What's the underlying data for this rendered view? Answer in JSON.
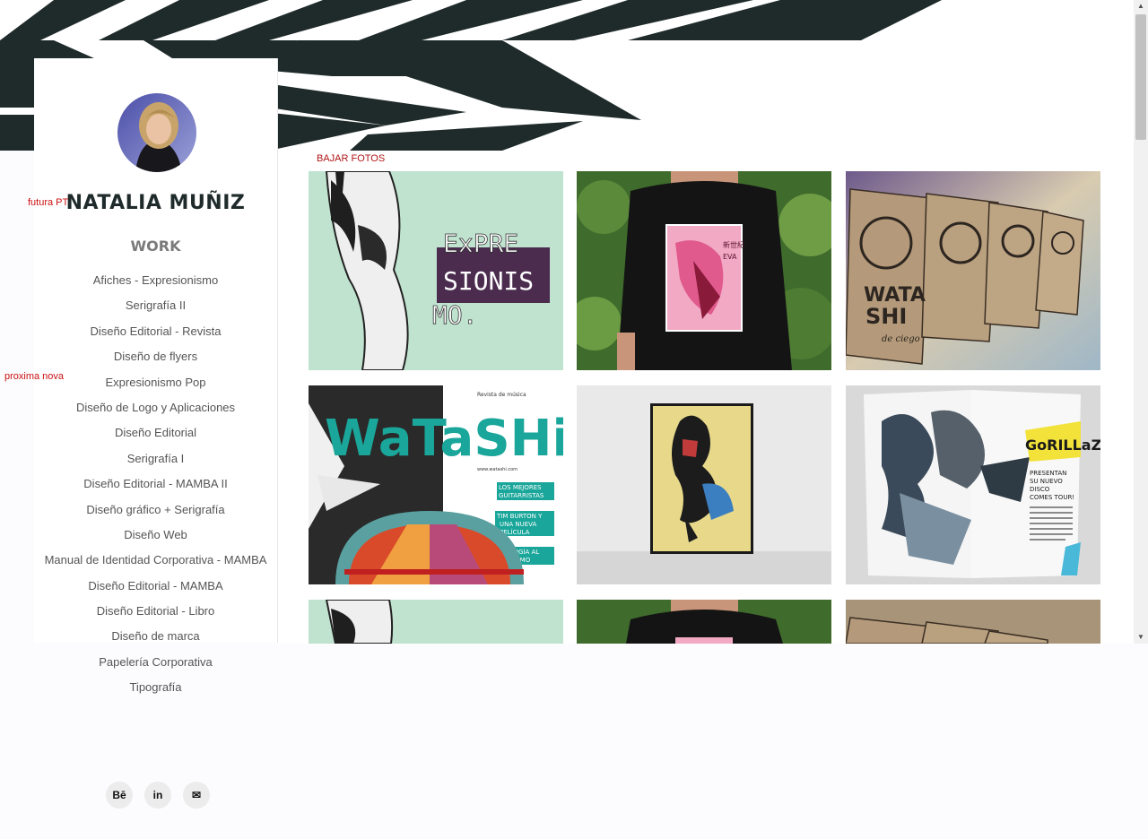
{
  "profile": {
    "name": "NATALIA MUÑIZ",
    "section_title": "WORK"
  },
  "annotations": {
    "font_note": "futura PT",
    "nav_note": "proxima nova",
    "download_label": "BAJAR FOTOS"
  },
  "nav": {
    "items": [
      "Afiches - Expresionismo",
      "Serigrafía II",
      "Diseño Editorial - Revista",
      "Diseño de flyers",
      "Expresionismo Pop",
      "Diseño de Logo y Aplicaciones",
      "Diseño Editorial",
      "Serigrafía I",
      "Diseño Editorial - MAMBA II",
      "Diseño gráfico + Serigrafía",
      "Diseño Web",
      "Manual de Identidad Corporativa - MAMBA",
      "Diseño Editorial - MAMBA",
      "Diseño Editorial - Libro",
      "Diseño de marca",
      "Papelería Corporativa",
      "Tipografía"
    ]
  },
  "social": {
    "behance_label": "Bē",
    "linkedin_label": "in",
    "email_label": "✉"
  },
  "gallery": {
    "poster_text": {
      "line1": "ExPRE",
      "line2": "SIONIS",
      "line3": "MO."
    },
    "magazine_text": {
      "title": "WaTaSHi",
      "kicker": "Revista de música",
      "web": "www.watashi.com",
      "headline1": "LOS MEJORES",
      "headline2": "GUITARRISTAS",
      "headline3": "TIM BURTON Y",
      "headline4": "UNA NUEVA",
      "headline5": "PELÍCULA",
      "headline6": "ECOLOGÍA AL",
      "headline7": "EXTREMO"
    },
    "cards_text": {
      "word1": "WATA",
      "word2": "SHI",
      "tag": "de ciego"
    },
    "spread_text": {
      "title": "GoRILLaZ",
      "sub1": "PRESENTAN",
      "sub2": "SU NUEVO",
      "sub3": "DISCO",
      "sub4": "COMES TOUR!"
    },
    "shirt_text": {
      "tag1": "新世紀",
      "tag2": "EVA"
    }
  },
  "colors": {
    "banner_dark": "#1f2a2a",
    "poster_green": "#bfe3cf",
    "poster_purple": "#4b2c4f",
    "watashi_teal": "#1aa69a",
    "annotation_red": "#cc1111"
  }
}
